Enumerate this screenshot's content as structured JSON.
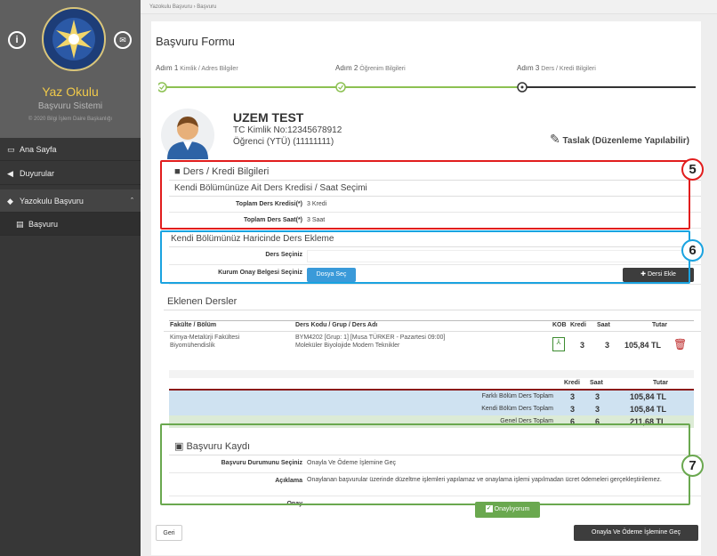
{
  "sidebar": {
    "app_title": "Yaz Okulu",
    "app_subtitle": "Başvuru Sistemi",
    "copyright": "© 2020 Bilgi İşlem Daire Başkanlığı",
    "info_btn": "i",
    "mail_btn": "✉",
    "nav": [
      {
        "label": "Ana Sayfa",
        "icon": "monitor-icon"
      },
      {
        "label": "Duyurular",
        "icon": "megaphone-icon"
      },
      {
        "label": "Yazokulu Başvuru",
        "icon": "graduation-cap-icon"
      },
      {
        "label": "Başvuru",
        "icon": "document-icon"
      }
    ]
  },
  "breadcrumb": {
    "root": "Yazokulu Başvuru",
    "sep": "›",
    "current": "Başvuru"
  },
  "form": {
    "title": "Başvuru Formu",
    "steps": [
      {
        "num": "Adım 1",
        "label": "Kimlik / Adres Bilgiler"
      },
      {
        "num": "Adım 2",
        "label": "Öğrenim Bilgileri"
      },
      {
        "num": "Adım 3",
        "label": "Ders / Kredi Bilgileri"
      }
    ]
  },
  "user": {
    "name": "UZEM TEST",
    "tc": "TC Kimlik No:12345678912",
    "student": "Öğrenci (YTÜ) (11111111)",
    "draft_label": "Taslak (Düzenleme Yapılabilir)"
  },
  "credit_section": {
    "title": "Ders / Kredi Bilgileri",
    "subtitle": "Kendi Bölümünüze Ait Ders Kredisi / Saat Seçimi",
    "total_credit_label": "Toplam Ders Kredisi(*)",
    "total_credit_value": "3 Kredi",
    "total_hours_label": "Toplam Ders Saat(*)",
    "total_hours_value": "3 Saat"
  },
  "add_course": {
    "title": "Kendi Bölümünüz Haricinde Ders Ekleme",
    "select_label": "Ders Seçiniz",
    "doc_label": "Kurum Onay Belgesi Seçiniz",
    "file_btn": "Dosya Seç",
    "add_btn": "Dersi Ekle"
  },
  "added_courses": {
    "title": "Eklenen Dersler",
    "headers": {
      "faculty": "Fakülte / Bölüm",
      "course": "Ders Kodu / Grup / Ders Adı",
      "kob": "KOB",
      "credit": "Kredi",
      "hours": "Saat",
      "fee": "Tutar"
    },
    "rows": [
      {
        "faculty": "Kimya-Metalürji Fakültesi",
        "dept": "Biyomühendislik",
        "course_line1": "BYM4202 [Grup: 1] [Musa TÜRKER - Pazartesi 09:00]",
        "course_line2": "Moleküler Biyolojide Modern Teknikler",
        "credit": "3",
        "hours": "3",
        "fee": "105,84 TL"
      }
    ],
    "summary_headers": {
      "credit": "Kredi",
      "hours": "Saat",
      "fee": "Tutar"
    },
    "summary": [
      {
        "label": "Farklı Bölüm Ders Toplam",
        "credit": "3",
        "hours": "3",
        "fee": "105,84 TL",
        "color": "#cfe2f1"
      },
      {
        "label": "Kendi Bölüm Ders Toplam",
        "credit": "3",
        "hours": "3",
        "fee": "105,84 TL",
        "color": "#cfe2f1"
      },
      {
        "label": "Genel Ders Toplam",
        "credit": "6",
        "hours": "6",
        "fee": "211,68 TL",
        "color": "#dcebd6"
      }
    ]
  },
  "registration": {
    "title": "Başvuru Kaydı",
    "status_label": "Başvuru Durumunu Seçiniz",
    "status_value": "Onayla Ve Ödeme İşlemine Geç",
    "desc_label": "Açıklama",
    "desc_value": "Onaylanan başvurular üzerinde düzeltme işlemleri yapılamaz ve onaylama işlemi yapılmadan ücret ödemeleri gerçekleştirilemez.",
    "approve_label": "Onay",
    "approve_btn": "Onaylıyorum"
  },
  "footer": {
    "back_btn": "Geri",
    "submit_btn": "Onayla Ve Ödeme İşlemine Geç"
  },
  "annotations": [
    {
      "num": "5",
      "color": "#e11d1d"
    },
    {
      "num": "6",
      "color": "#1aa3e0"
    },
    {
      "num": "7",
      "color": "#6aa84f"
    }
  ]
}
